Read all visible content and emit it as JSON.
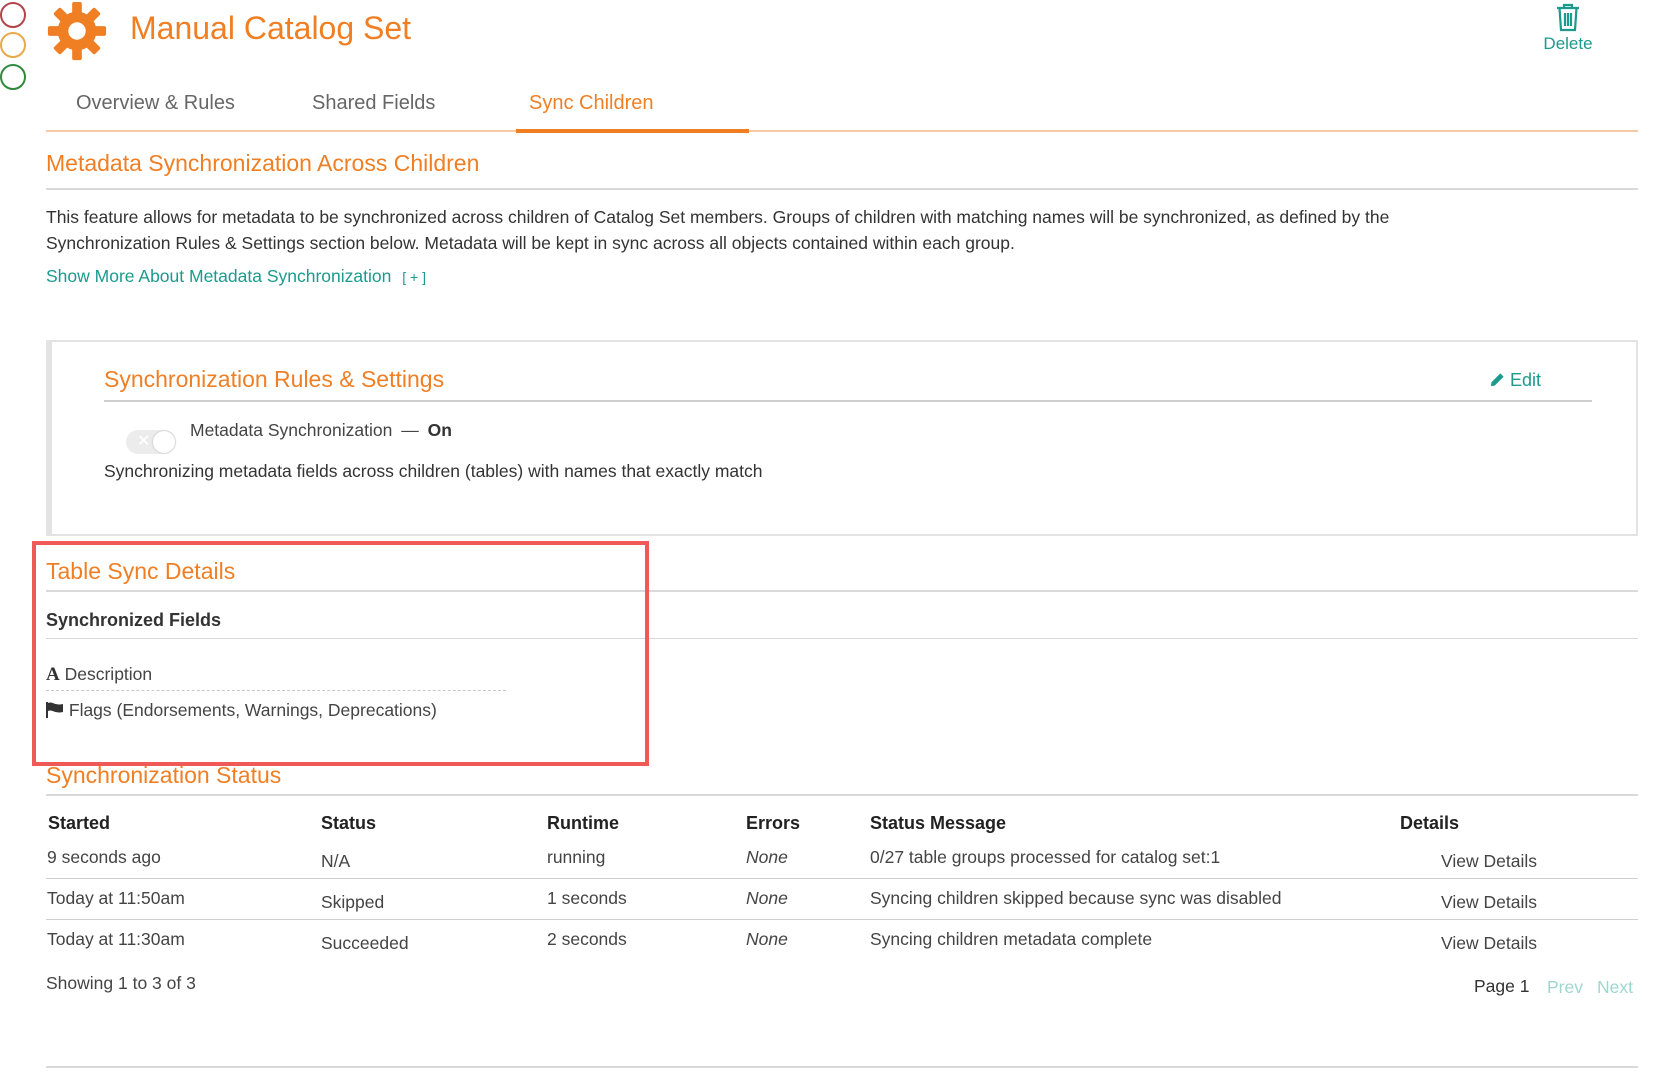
{
  "window": {
    "controls": [
      "close",
      "minimize",
      "zoom"
    ]
  },
  "header": {
    "title": "Manual Catalog Set",
    "icon": "gear-icon",
    "delete_label": "Delete",
    "delete_icon": "trash-icon"
  },
  "tabs": [
    {
      "label": "Overview & Rules",
      "active": false
    },
    {
      "label": "Shared Fields",
      "active": false
    },
    {
      "label": "Sync Children",
      "active": true
    }
  ],
  "metadata_section": {
    "title": "Metadata Synchronization Across Children",
    "description_line1": "This feature allows for metadata to be synchronized across children of Catalog Set members. Groups of children with matching names will be synchronized, as defined by the",
    "description_line2": "Synchronization Rules & Settings section below. Metadata will be kept in sync across all objects contained within each group.",
    "show_more_label": "Show More About Metadata Synchronization",
    "show_more_toggle": "[ + ]"
  },
  "rules_settings": {
    "title": "Synchronization Rules & Settings",
    "edit_label": "Edit",
    "toggle_label": "Metadata Synchronization",
    "toggle_separator": "—",
    "toggle_state": "On",
    "description": "Synchronizing metadata fields across children (tables) with names that exactly match"
  },
  "table_sync": {
    "title": "Table Sync Details",
    "subtitle": "Synchronized Fields",
    "fields": [
      {
        "icon": "text-a-icon",
        "label": "Description"
      },
      {
        "icon": "flag-icon",
        "label": "Flags (Endorsements, Warnings, Deprecations)"
      }
    ]
  },
  "sync_status": {
    "title": "Synchronization Status",
    "columns": [
      "Started",
      "Status",
      "Runtime",
      "Errors",
      "Status Message",
      "Details"
    ],
    "rows": [
      {
        "started": "9 seconds ago",
        "status": "N/A",
        "runtime": "running",
        "errors": "None",
        "message": "0/27 table groups processed for catalog set:1",
        "details": "View Details"
      },
      {
        "started": "Today at 11:50am",
        "status": "Skipped",
        "runtime": "1 seconds",
        "errors": "None",
        "message": "Syncing children skipped because sync was disabled",
        "details": "View Details"
      },
      {
        "started": "Today at 11:30am",
        "status": "Succeeded",
        "runtime": "2 seconds",
        "errors": "None",
        "message": "Syncing children metadata complete",
        "details": "View Details"
      }
    ],
    "showing": "Showing 1 to 3 of 3",
    "page_label": "Page 1",
    "prev_label": "Prev",
    "next_label": "Next"
  },
  "colors": {
    "accent": "#f07f24",
    "link": "#1b9a8d",
    "highlight_border": "#ef5a57"
  }
}
